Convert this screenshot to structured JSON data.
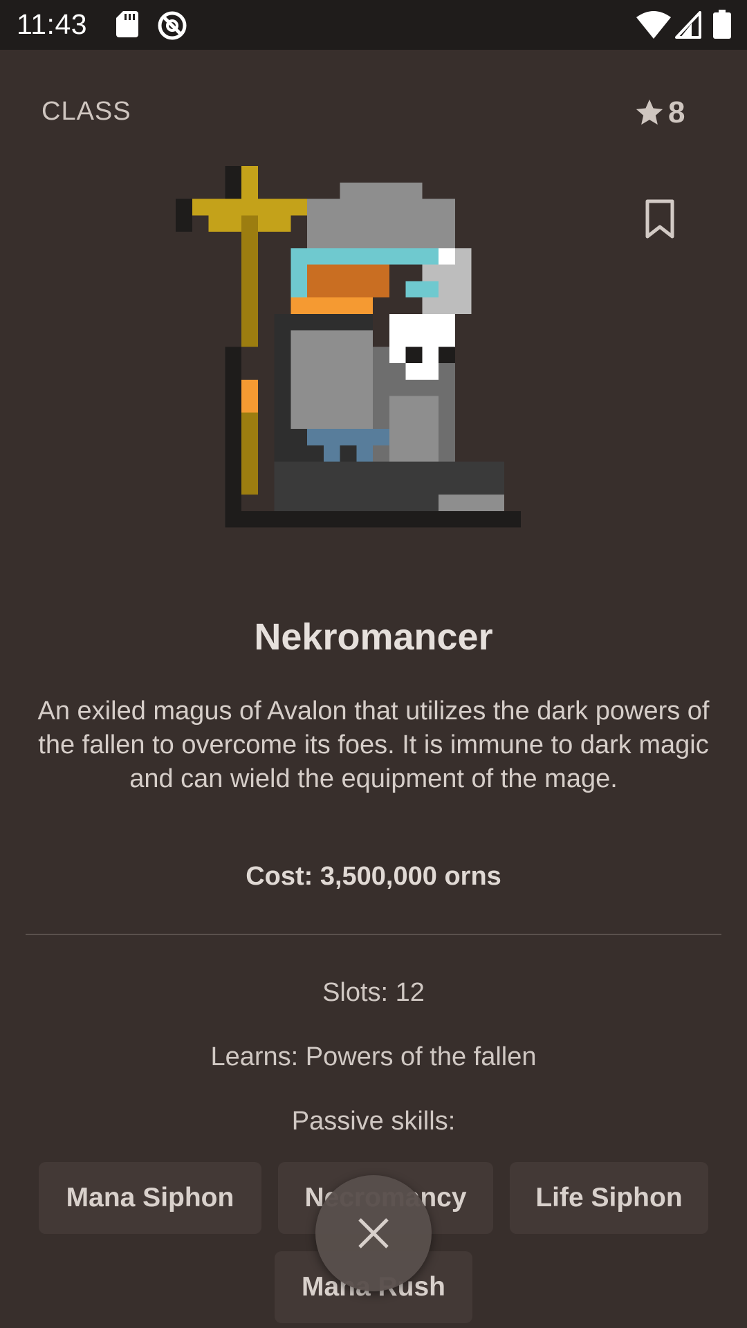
{
  "status_bar": {
    "time": "11:43",
    "icons": [
      "sd-card-icon",
      "sync-disabled-icon",
      "wifi-icon",
      "cell-signal-icon",
      "battery-icon"
    ]
  },
  "header": {
    "label": "CLASS",
    "rating": "8",
    "rating_icon": "star-icon",
    "bookmark_icon": "bookmark-icon"
  },
  "class_info": {
    "name": "Nekromancer",
    "description": "An exiled magus of Avalon that utilizes the dark powers of the fallen to overcome its foes. It is immune to dark magic and can wield the equipment of the mage.",
    "cost": "Cost: 3,500,000 orns",
    "slots": "Slots: 12",
    "learns": "Learns: Powers of the fallen",
    "passive_label": "Passive skills:"
  },
  "passive_skills": [
    "Mana Siphon",
    "Necromancy",
    "Life Siphon",
    "Mana Rush"
  ],
  "close_icon": "close-icon",
  "colors": {
    "background": "#382f2c",
    "status_bar": "#1f1c1b",
    "chip": "#433936",
    "fab": "#584f4c"
  }
}
